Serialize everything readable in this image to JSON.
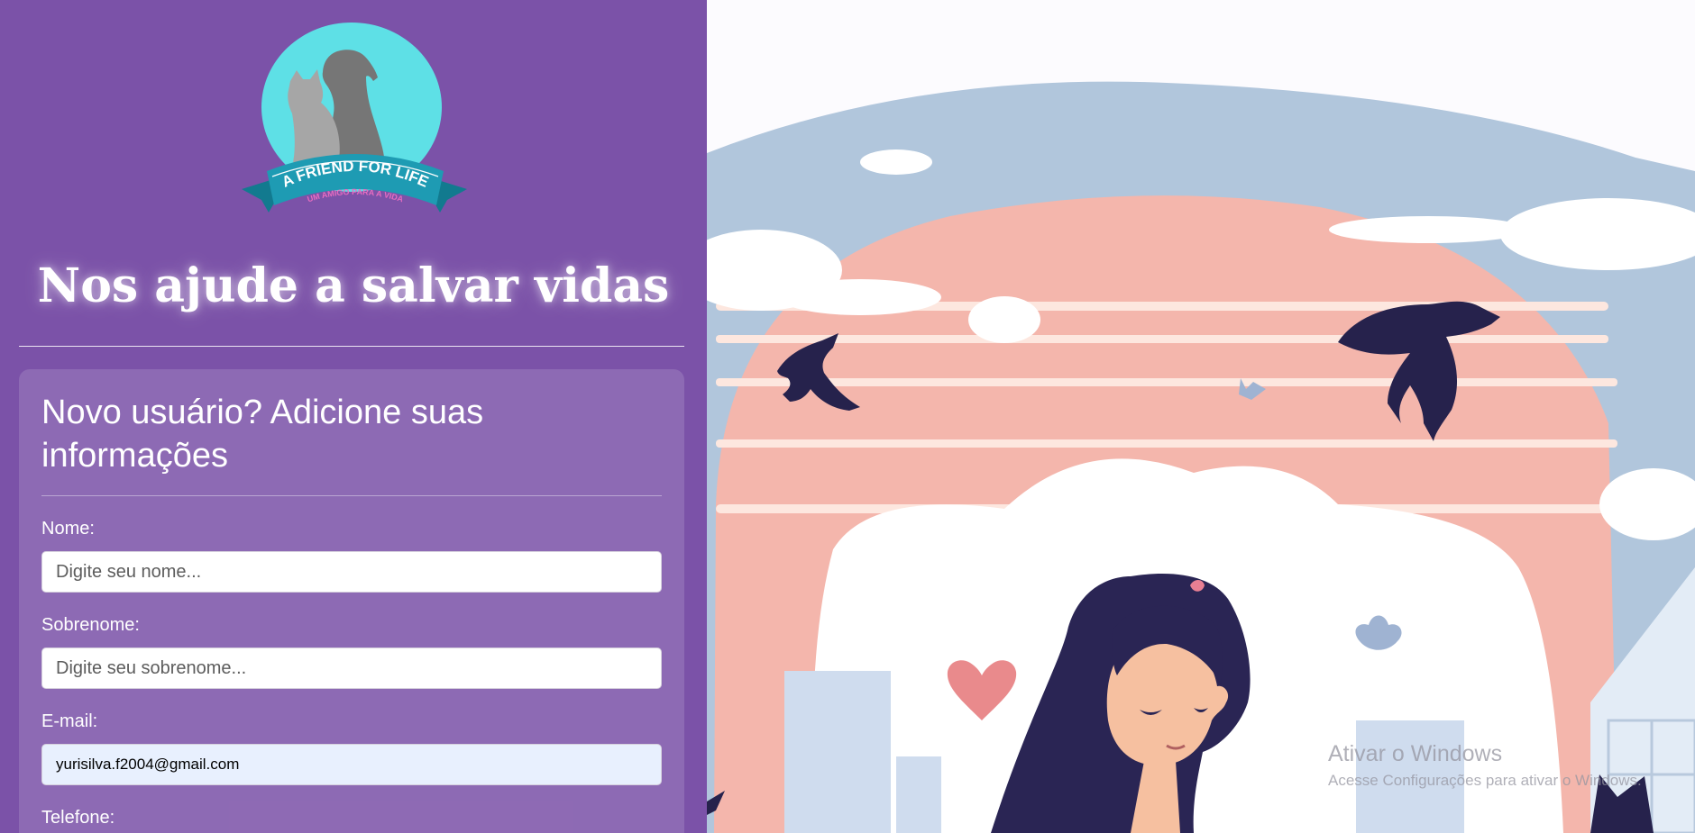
{
  "logo": {
    "brand_text": "A FRIEND FOR LIFE",
    "tagline_text": "UM AMIGO PARA A VIDA",
    "colors": {
      "circle": "#5ee0e6",
      "ribbon": "#1e9bb3",
      "ribbon_dark": "#127a8f",
      "dog": "#767676",
      "cat": "#a6a6a6",
      "tagline": "#e66cc0"
    }
  },
  "hero": {
    "headline": "Nos ajude a salvar vidas"
  },
  "form": {
    "title": "Novo usuário? Adicione suas informações",
    "fields": [
      {
        "label": "Nome:",
        "placeholder": "Digite seu nome...",
        "value": ""
      },
      {
        "label": "Sobrenome:",
        "placeholder": "Digite seu sobrenome...",
        "value": ""
      },
      {
        "label": "E-mail:",
        "placeholder": "",
        "value": "yurisilva.f2004@gmail.com"
      },
      {
        "label": "Telefone:"
      }
    ]
  },
  "watermark": {
    "title": "Ativar o Windows",
    "subtitle": "Acesse Configurações para ativar o Windows."
  },
  "colors": {
    "panel": "#7b52a8",
    "card": "rgba(255,255,255,0.14)",
    "autofill": "#e8f0fe"
  }
}
